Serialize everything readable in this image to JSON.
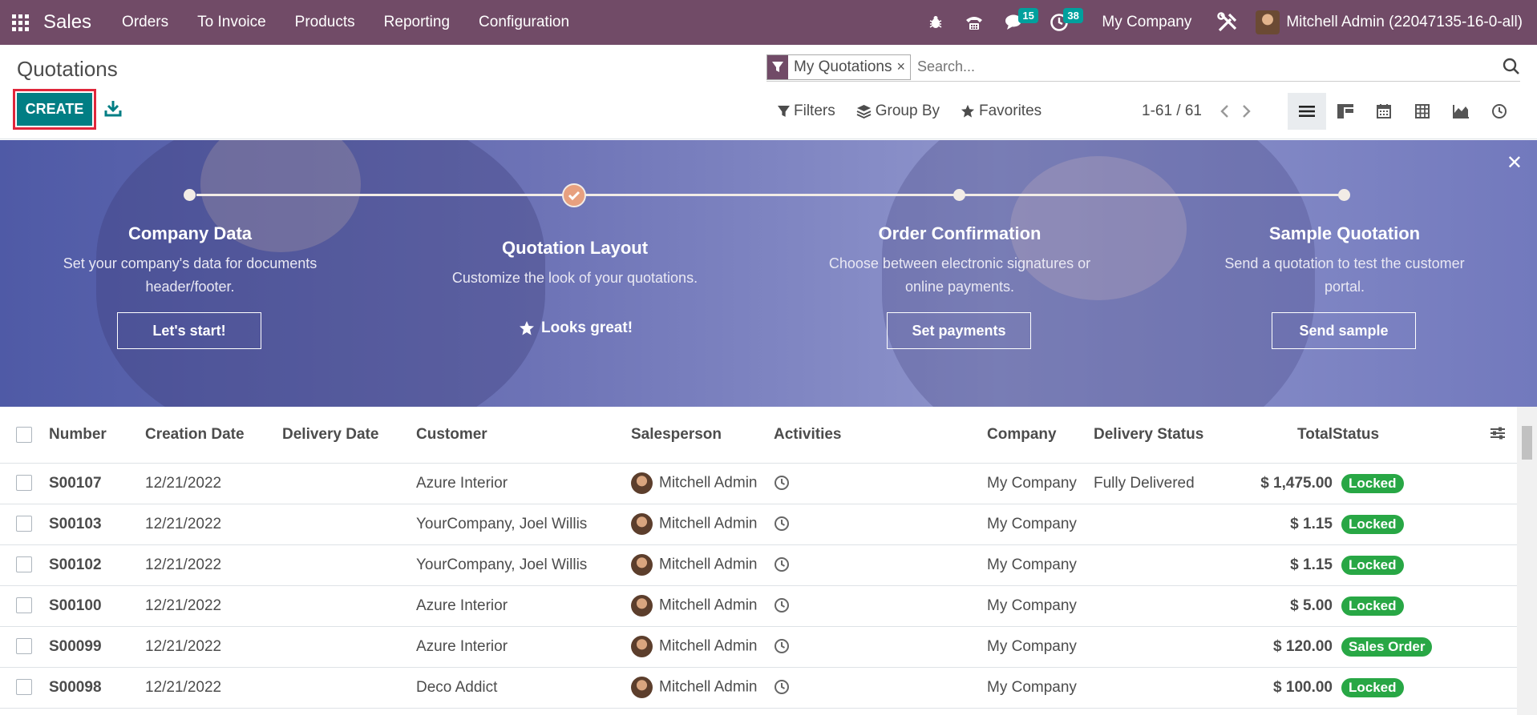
{
  "navbar": {
    "app_name": "Sales",
    "menu": [
      "Orders",
      "To Invoice",
      "Products",
      "Reporting",
      "Configuration"
    ],
    "messages_count": "15",
    "activities_count": "38",
    "company": "My Company",
    "user": "Mitchell Admin (22047135-16-0-all)"
  },
  "control": {
    "title": "Quotations",
    "create_label": "CREATE",
    "facet_label": "My Quotations",
    "search_placeholder": "Search...",
    "filters_label": "Filters",
    "groupby_label": "Group By",
    "favorites_label": "Favorites",
    "pager": "1-61 / 61"
  },
  "banner": {
    "steps": [
      {
        "title": "Company Data",
        "desc1": "Set your company's data for documents",
        "desc2": "header/footer.",
        "button": "Let's start!"
      },
      {
        "title": "Quotation Layout",
        "desc1": "Customize the look of your quotations.",
        "done_label": "Looks great!"
      },
      {
        "title": "Order Confirmation",
        "desc1": "Choose between electronic signatures or",
        "desc2": "online payments.",
        "button": "Set payments"
      },
      {
        "title": "Sample Quotation",
        "desc1": "Send a quotation to test the customer",
        "desc2": "portal.",
        "button": "Send sample"
      }
    ]
  },
  "table": {
    "columns": [
      "Number",
      "Creation Date",
      "Delivery Date",
      "Customer",
      "Salesperson",
      "Activities",
      "Company",
      "Delivery Status",
      "Total",
      "Status"
    ],
    "rows": [
      {
        "number": "S00107",
        "created": "12/21/2022",
        "delivery": "",
        "customer": "Azure Interior",
        "salesperson": "Mitchell Admin",
        "company": "My Company",
        "delivery_status": "Fully Delivered",
        "total": "$ 1,475.00",
        "status": "Locked"
      },
      {
        "number": "S00103",
        "created": "12/21/2022",
        "delivery": "",
        "customer": "YourCompany, Joel Willis",
        "salesperson": "Mitchell Admin",
        "company": "My Company",
        "delivery_status": "",
        "total": "$ 1.15",
        "status": "Locked"
      },
      {
        "number": "S00102",
        "created": "12/21/2022",
        "delivery": "",
        "customer": "YourCompany, Joel Willis",
        "salesperson": "Mitchell Admin",
        "company": "My Company",
        "delivery_status": "",
        "total": "$ 1.15",
        "status": "Locked"
      },
      {
        "number": "S00100",
        "created": "12/21/2022",
        "delivery": "",
        "customer": "Azure Interior",
        "salesperson": "Mitchell Admin",
        "company": "My Company",
        "delivery_status": "",
        "total": "$ 5.00",
        "status": "Locked"
      },
      {
        "number": "S00099",
        "created": "12/21/2022",
        "delivery": "",
        "customer": "Azure Interior",
        "salesperson": "Mitchell Admin",
        "company": "My Company",
        "delivery_status": "",
        "total": "$ 120.00",
        "status": "Sales Order"
      },
      {
        "number": "S00098",
        "created": "12/21/2022",
        "delivery": "",
        "customer": "Deco Addict",
        "salesperson": "Mitchell Admin",
        "company": "My Company",
        "delivery_status": "",
        "total": "$ 100.00",
        "status": "Locked"
      }
    ]
  },
  "colors": {
    "navbar": "#714b67",
    "primary": "#017e84",
    "status_green": "#28a745",
    "badge_teal": "#00a09d",
    "highlight_red": "#e0263b"
  }
}
